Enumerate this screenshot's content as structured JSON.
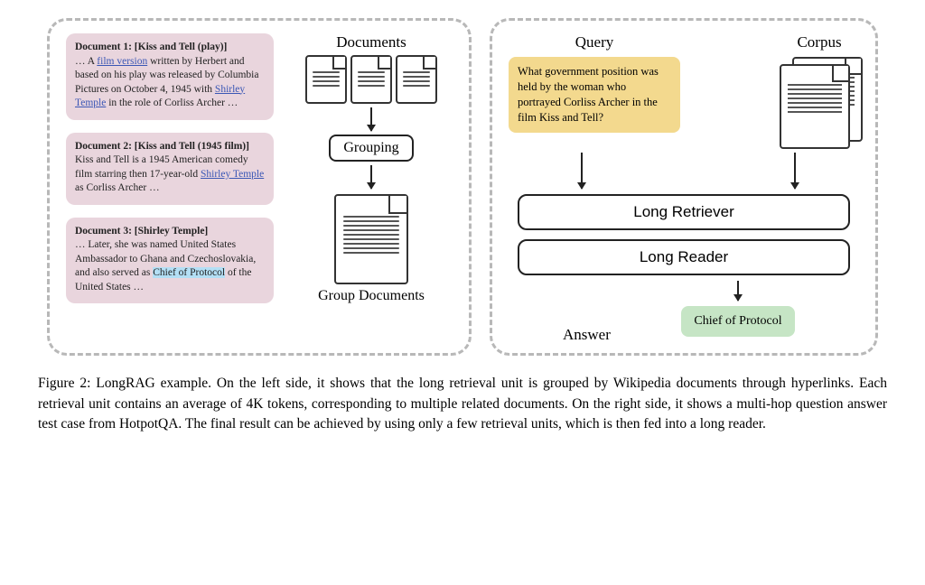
{
  "left": {
    "doc1_title": "Document 1: [Kiss and Tell (play)]",
    "doc1_pre": "… A ",
    "doc1_link1": "film version",
    "doc1_mid": " written by Herbert and based on his play was released by Columbia Pictures on October 4, 1945 with ",
    "doc1_link2": "Shirley Temple",
    "doc1_post": " in the role of Corliss Archer …",
    "doc2_title": "Document 2: [Kiss and Tell (1945 film)]",
    "doc2_pre": "Kiss and Tell is a 1945 American comedy film starring then 17-year-old ",
    "doc2_link": "Shirley Temple",
    "doc2_post": " as Corliss Archer …",
    "doc3_title": "Document 3: [Shirley Temple]",
    "doc3_pre": "… Later, she was named United States Ambassador to Ghana and Czechoslovakia, and also served as ",
    "doc3_hl": "Chief of Protocol",
    "doc3_post": " of the United States …",
    "documents_label": "Documents",
    "grouping_label": "Grouping",
    "group_documents_label": "Group Documents"
  },
  "right": {
    "query_label": "Query",
    "corpus_label": "Corpus",
    "query_text": "What government position was held by the woman who portrayed Corliss Archer in the film Kiss and Tell?",
    "retriever_label": "Long Retriever",
    "reader_label": "Long Reader",
    "answer_label": "Answer",
    "answer_text": "Chief of Protocol"
  },
  "caption": "Figure 2: LongRAG example. On the left side, it shows that the long retrieval unit is grouped by Wikipedia documents through hyperlinks. Each retrieval unit contains an average of 4K tokens, corresponding to multiple related documents. On the right side, it shows a multi-hop question answer test case from HotpotQA. The final result can be achieved by using only a few retrieval units, which is then fed into a long reader."
}
